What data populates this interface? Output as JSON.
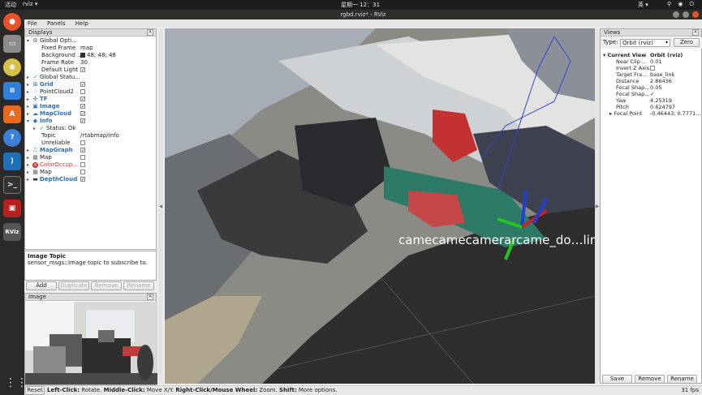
{
  "topbar": {
    "activities": "活动",
    "app": "rviz ▾",
    "clock": "星期一 12：31",
    "lang": "英 ▾",
    "tray": "⚲ ◉ ⏻ ▾"
  },
  "window": {
    "title": "rgbd.rviz* - RViz"
  },
  "menu": {
    "file": "File",
    "panels": "Panels",
    "help": "Help"
  },
  "displays": {
    "title": "Displays",
    "rows": [
      {
        "name": "Global Opti...",
        "value": ""
      },
      {
        "name": "Fixed Frame",
        "value": "map"
      },
      {
        "name": "Background ...",
        "value": "48; 48; 48"
      },
      {
        "name": "Frame Rate",
        "value": "30"
      },
      {
        "name": "Default Light",
        "value": "✓"
      },
      {
        "name": "Global Statu...",
        "value": ""
      },
      {
        "name": "Grid",
        "value": "✓"
      },
      {
        "name": "PointCloud2",
        "value": ""
      },
      {
        "name": "TF",
        "value": "✓"
      },
      {
        "name": "Image",
        "value": "✓"
      },
      {
        "name": "MapCloud",
        "value": "✓"
      },
      {
        "name": "Info",
        "value": "✓"
      },
      {
        "name": "Status: Ok",
        "value": ""
      },
      {
        "name": "Topic",
        "value": "/rtabmap/info"
      },
      {
        "name": "Unreliable",
        "value": ""
      },
      {
        "name": "MapGraph",
        "value": "✓"
      },
      {
        "name": "Map",
        "value": ""
      },
      {
        "name": "ColorOccup...",
        "value": ""
      },
      {
        "name": "Map",
        "value": ""
      },
      {
        "name": "DepthCloud",
        "value": "✓"
      }
    ]
  },
  "description": {
    "heading": "Image Topic",
    "text": "sensor_msgs::Image topic to subscribe to."
  },
  "display_buttons": {
    "add": "Add",
    "duplicate": "Duplicate",
    "remove": "Remove",
    "rename": "Rename"
  },
  "image_panel": {
    "title": "Image"
  },
  "viewport": {
    "tf_label": "camecamecamerarcame_do…link"
  },
  "views": {
    "title": "Views",
    "type_label": "Type:",
    "type_value": "Orbit (rviz)",
    "zero": "Zero",
    "rows": [
      {
        "name": "Current View",
        "value": "Orbit (rviz)"
      },
      {
        "name": "Near Clip ...",
        "value": "0.01"
      },
      {
        "name": "Invert Z Axis",
        "value": ""
      },
      {
        "name": "Target Fra...",
        "value": "base_link"
      },
      {
        "name": "Distance",
        "value": "2.86436"
      },
      {
        "name": "Focal Shap...",
        "value": "0.05"
      },
      {
        "name": "Focal Shap...",
        "value": "✓"
      },
      {
        "name": "Yaw",
        "value": "4.25319"
      },
      {
        "name": "Pitch",
        "value": "0.624797"
      },
      {
        "name": "Focal Point",
        "value": "-0.46443; 0.7771..."
      }
    ],
    "save": "Save",
    "remove": "Remove",
    "rename": "Rename"
  },
  "status": {
    "reset": "Reset",
    "left_click": "Left-Click:",
    "left_text": " Rotate. ",
    "middle_click": "Middle-Click:",
    "middle_text": " Move X/Y. ",
    "right_click": "Right-Click/Mouse Wheel:",
    "right_text": " Zoom. ",
    "shift": "Shift:",
    "shift_text": " More options.",
    "fps": "31 fps"
  }
}
